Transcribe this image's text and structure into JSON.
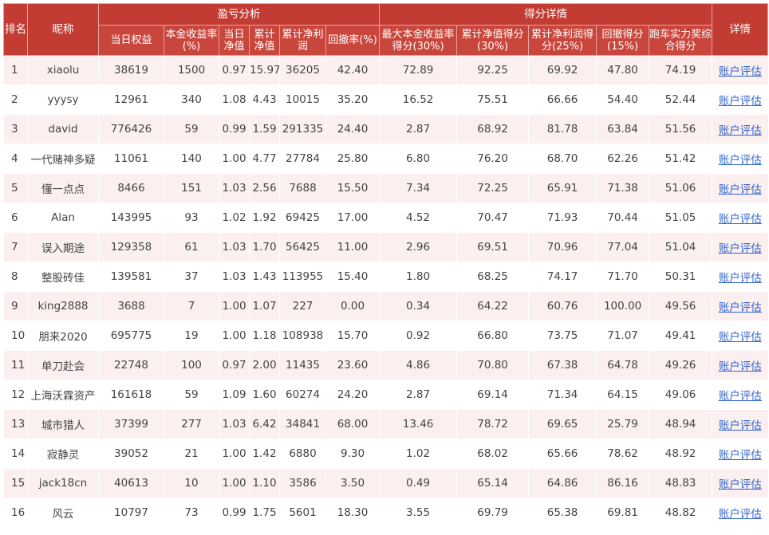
{
  "header": {
    "rank": "排名",
    "nickname": "昵称",
    "group_profit": "盈亏分析",
    "group_score": "得分详情",
    "detail": "详情",
    "cols": [
      "当日权益",
      "本金收益率(%)",
      "当日净值",
      "累计净值",
      "累计净利润",
      "回撤率(%)",
      "最大本金收益率得分(30%)",
      "累计净值得分(30%)",
      "累计净利润得分(25%)",
      "回撤得分(15%)",
      "跑车实力奖综合得分"
    ]
  },
  "link_label": "账户评估",
  "rows": [
    {
      "rank": "1",
      "nick": "xiaolu",
      "equity": "38619",
      "ret": "1500",
      "nav": "0.97",
      "cum_nav": "15.97",
      "profit": "36205",
      "dd": "42.40",
      "s1": "72.89",
      "s2": "92.25",
      "s3": "69.92",
      "s4": "47.80",
      "total": "74.19"
    },
    {
      "rank": "2",
      "nick": "yyysy",
      "equity": "12961",
      "ret": "340",
      "nav": "1.08",
      "cum_nav": "4.43",
      "profit": "10015",
      "dd": "35.20",
      "s1": "16.52",
      "s2": "75.51",
      "s3": "66.66",
      "s4": "54.40",
      "total": "52.44"
    },
    {
      "rank": "3",
      "nick": "david",
      "equity": "776426",
      "ret": "59",
      "nav": "0.99",
      "cum_nav": "1.59",
      "profit": "291335",
      "dd": "24.40",
      "s1": "2.87",
      "s2": "68.92",
      "s3": "81.78",
      "s4": "63.84",
      "total": "51.56"
    },
    {
      "rank": "4",
      "nick": "一代赌神多疑",
      "equity": "11061",
      "ret": "140",
      "nav": "1.00",
      "cum_nav": "4.77",
      "profit": "27784",
      "dd": "25.80",
      "s1": "6.80",
      "s2": "76.20",
      "s3": "68.70",
      "s4": "62.26",
      "total": "51.42"
    },
    {
      "rank": "5",
      "nick": "懂一点点",
      "equity": "8466",
      "ret": "151",
      "nav": "1.03",
      "cum_nav": "2.56",
      "profit": "7688",
      "dd": "15.50",
      "s1": "7.34",
      "s2": "72.25",
      "s3": "65.91",
      "s4": "71.38",
      "total": "51.06"
    },
    {
      "rank": "6",
      "nick": "Alan",
      "equity": "143995",
      "ret": "93",
      "nav": "1.02",
      "cum_nav": "1.92",
      "profit": "69425",
      "dd": "17.00",
      "s1": "4.52",
      "s2": "70.47",
      "s3": "71.93",
      "s4": "70.44",
      "total": "51.05"
    },
    {
      "rank": "7",
      "nick": "误入期途",
      "equity": "129358",
      "ret": "61",
      "nav": "1.03",
      "cum_nav": "1.70",
      "profit": "56425",
      "dd": "11.00",
      "s1": "2.96",
      "s2": "69.51",
      "s3": "70.96",
      "s4": "77.04",
      "total": "51.04"
    },
    {
      "rank": "8",
      "nick": "整股砖佳",
      "equity": "139581",
      "ret": "37",
      "nav": "1.03",
      "cum_nav": "1.43",
      "profit": "113955",
      "dd": "15.40",
      "s1": "1.80",
      "s2": "68.25",
      "s3": "74.17",
      "s4": "71.70",
      "total": "50.31"
    },
    {
      "rank": "9",
      "nick": "king2888",
      "equity": "3688",
      "ret": "7",
      "nav": "1.00",
      "cum_nav": "1.07",
      "profit": "227",
      "dd": "0.00",
      "s1": "0.34",
      "s2": "64.22",
      "s3": "60.76",
      "s4": "100.00",
      "total": "49.56"
    },
    {
      "rank": "10",
      "nick": "朋来2020",
      "equity": "695775",
      "ret": "19",
      "nav": "1.00",
      "cum_nav": "1.18",
      "profit": "108938",
      "dd": "15.70",
      "s1": "0.92",
      "s2": "66.80",
      "s3": "73.75",
      "s4": "71.07",
      "total": "49.41"
    },
    {
      "rank": "11",
      "nick": "单刀赴会",
      "equity": "22748",
      "ret": "100",
      "nav": "0.97",
      "cum_nav": "2.00",
      "profit": "11435",
      "dd": "23.60",
      "s1": "4.86",
      "s2": "70.80",
      "s3": "67.38",
      "s4": "64.78",
      "total": "49.26"
    },
    {
      "rank": "12",
      "nick": "上海沃霖资产",
      "equity": "161618",
      "ret": "59",
      "nav": "1.09",
      "cum_nav": "1.60",
      "profit": "60274",
      "dd": "24.20",
      "s1": "2.87",
      "s2": "69.14",
      "s3": "71.34",
      "s4": "64.15",
      "total": "49.06"
    },
    {
      "rank": "13",
      "nick": "城市猎人",
      "equity": "37399",
      "ret": "277",
      "nav": "1.03",
      "cum_nav": "6.42",
      "profit": "34841",
      "dd": "68.00",
      "s1": "13.46",
      "s2": "78.72",
      "s3": "69.65",
      "s4": "25.79",
      "total": "48.94"
    },
    {
      "rank": "14",
      "nick": "寂静灵",
      "equity": "39052",
      "ret": "21",
      "nav": "1.00",
      "cum_nav": "1.42",
      "profit": "6880",
      "dd": "9.30",
      "s1": "1.02",
      "s2": "68.02",
      "s3": "65.66",
      "s4": "78.62",
      "total": "48.92"
    },
    {
      "rank": "15",
      "nick": "jack18cn",
      "equity": "40613",
      "ret": "10",
      "nav": "1.00",
      "cum_nav": "1.10",
      "profit": "3586",
      "dd": "3.50",
      "s1": "0.49",
      "s2": "65.14",
      "s3": "64.86",
      "s4": "86.16",
      "total": "48.83"
    },
    {
      "rank": "16",
      "nick": "风云",
      "equity": "10797",
      "ret": "73",
      "nav": "0.99",
      "cum_nav": "1.75",
      "profit": "5601",
      "dd": "18.30",
      "s1": "3.55",
      "s2": "69.79",
      "s3": "65.38",
      "s4": "69.81",
      "total": "48.82"
    }
  ],
  "colors": {
    "header_bg": "#c23c33",
    "subheader_bg": "#c9463d",
    "odd_row_bg": "#fbeff0",
    "link": "#3366cc"
  }
}
